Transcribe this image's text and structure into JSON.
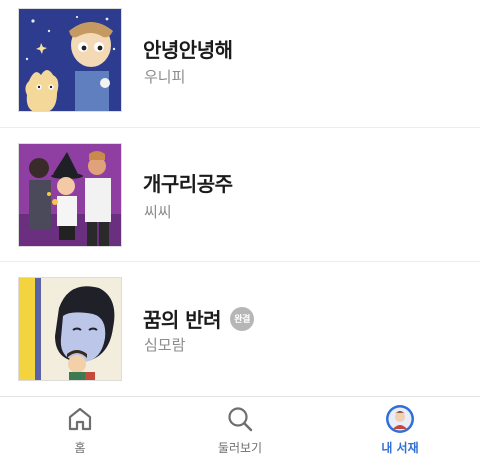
{
  "library": {
    "items": [
      {
        "title": "안녕안녕해",
        "author": "우니피",
        "badge": ""
      },
      {
        "title": "개구리공주",
        "author": "씨씨",
        "badge": ""
      },
      {
        "title": "꿈의 반려",
        "author": "심모람",
        "badge": "완결"
      }
    ]
  },
  "tabbar": {
    "tabs": [
      {
        "label": "홈",
        "icon": "home-icon",
        "active": false
      },
      {
        "label": "둘러보기",
        "icon": "search-icon",
        "active": false
      },
      {
        "label": "내 서재",
        "icon": "profile-avatar-icon",
        "active": true
      }
    ]
  },
  "colors": {
    "active_tab": "#2f6fd6",
    "inactive_tab": "#6e6e6e",
    "badge_bg": "#b6b6b6"
  }
}
